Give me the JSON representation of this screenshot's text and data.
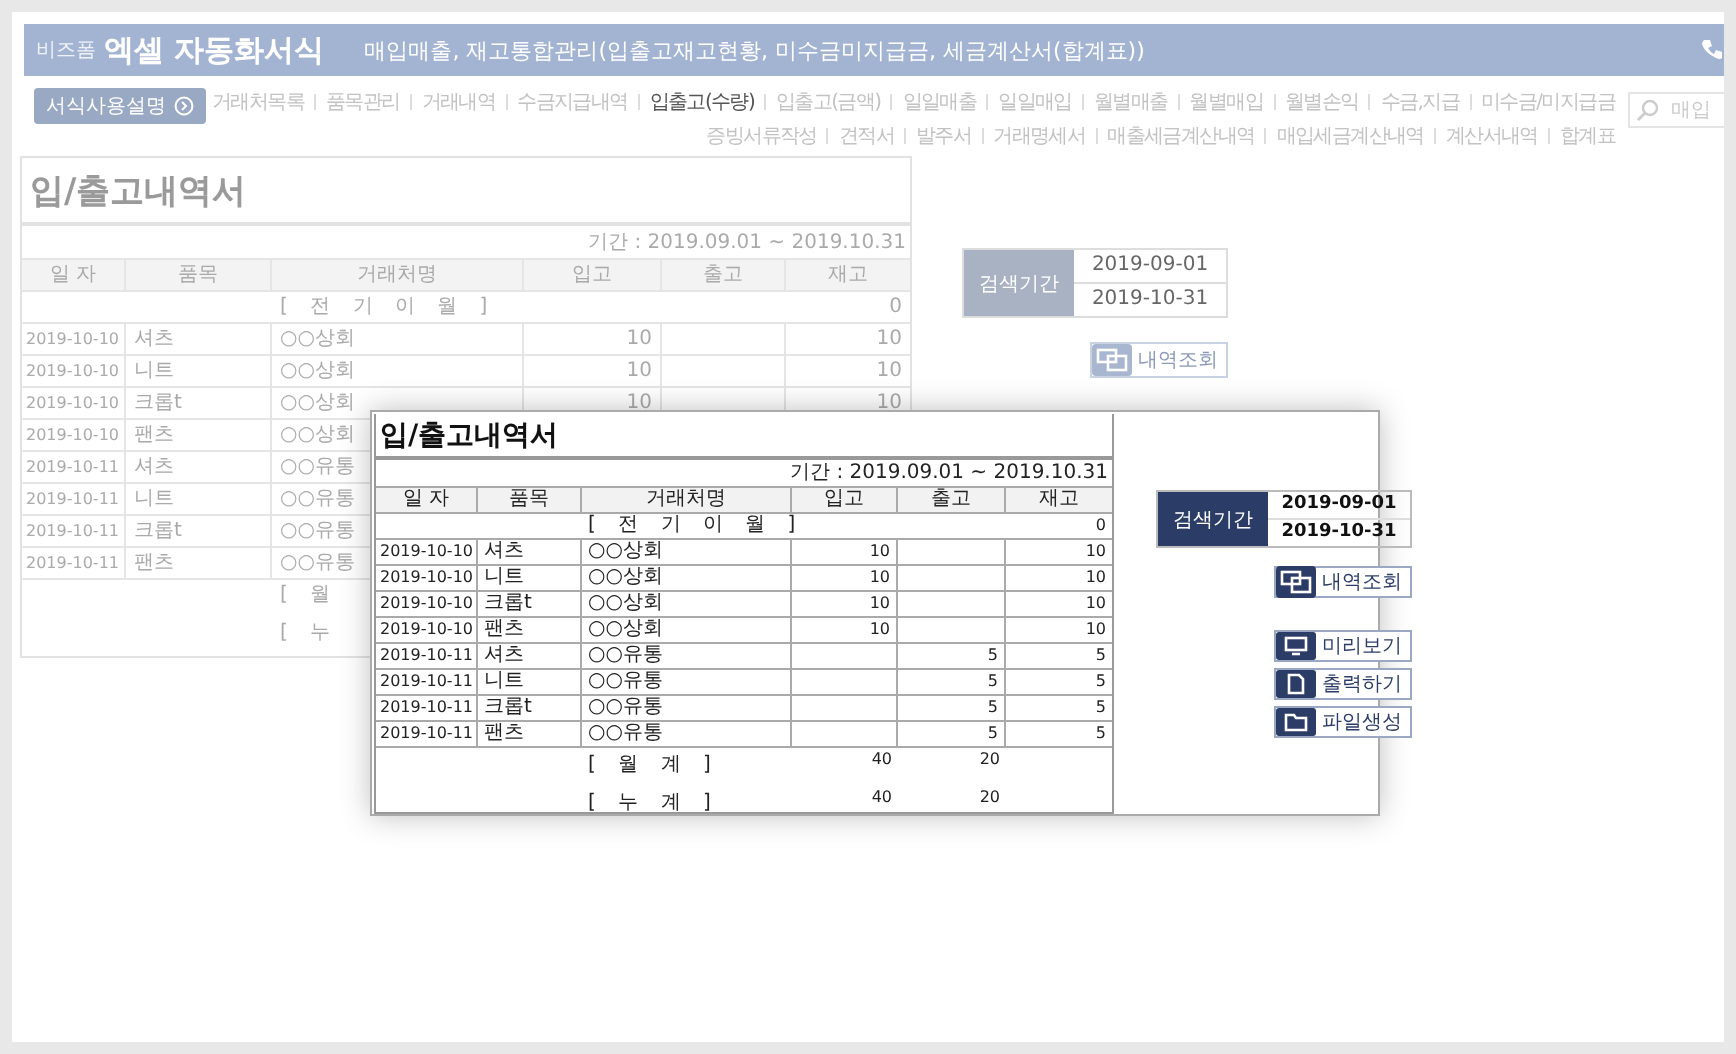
{
  "header": {
    "brand_small": "비즈폼",
    "brand": "엑셀 자동화서식",
    "subtitle": "매입매출, 재고통합관리(입출고재고현황, 미수금미지급금, 세금계산서(합계표))"
  },
  "guide_button": "서식사용설명",
  "nav_primary": [
    {
      "label": "거래처목록",
      "selected": false
    },
    {
      "label": "품목관리",
      "selected": false
    },
    {
      "label": "거래내역",
      "selected": false
    },
    {
      "label": "수금지급내역",
      "selected": false
    },
    {
      "label": "입출고(수량)",
      "selected": true
    },
    {
      "label": "입출고(금액)",
      "selected": false
    },
    {
      "label": "일일매출",
      "selected": false
    },
    {
      "label": "일일매입",
      "selected": false
    },
    {
      "label": "월별매출",
      "selected": false
    },
    {
      "label": "월별매입",
      "selected": false
    },
    {
      "label": "월별손익",
      "selected": false
    },
    {
      "label": "수금,지급",
      "selected": false
    },
    {
      "label": "미수금/미지급금",
      "selected": false
    }
  ],
  "nav_secondary": [
    {
      "label": "증빙서류작성",
      "selected": false
    },
    {
      "label": "견적서",
      "selected": false
    },
    {
      "label": "발주서",
      "selected": false
    },
    {
      "label": "거래명세서",
      "selected": false
    },
    {
      "label": "매출세금계산내역",
      "selected": false
    },
    {
      "label": "매입세금계산내역",
      "selected": false
    },
    {
      "label": "계산서내역",
      "selected": false
    },
    {
      "label": "합계표",
      "selected": false
    }
  ],
  "search": {
    "placeholder": "매입"
  },
  "background_sheet": {
    "title": "입/출고내역서",
    "period": "기간 : 2019.09.01 ~ 2019.10.31",
    "columns": [
      "일 자",
      "품목",
      "거래처명",
      "입고",
      "출고",
      "재고"
    ],
    "carry_row": {
      "label": "[ 전 기 이 월 ]",
      "stock": "0"
    },
    "rows": [
      {
        "date": "2019-10-10",
        "item": "셔츠",
        "partner": "○○상회",
        "in": "10",
        "stock": "10"
      },
      {
        "date": "2019-10-10",
        "item": "니트",
        "partner": "○○상회",
        "in": "10",
        "stock": "10"
      },
      {
        "date": "2019-10-10",
        "item": "크롭t",
        "partner": "○○상회",
        "in": "10",
        "stock": "10"
      },
      {
        "date": "2019-10-10",
        "item": "팬츠",
        "partner": "○○상회"
      },
      {
        "date": "2019-10-11",
        "item": "셔츠",
        "partner": "○○유통"
      },
      {
        "date": "2019-10-11",
        "item": "니트",
        "partner": "○○유통"
      },
      {
        "date": "2019-10-11",
        "item": "크롭t",
        "partner": "○○유통"
      },
      {
        "date": "2019-10-11",
        "item": "팬츠",
        "partner": "○○유통"
      }
    ],
    "totals": [
      {
        "label": "[ 월"
      },
      {
        "label": "[ 누"
      }
    ]
  },
  "background_panel": {
    "label": "검색기간",
    "from": "2019-09-01",
    "to": "2019-10-31",
    "button": "내역조회"
  },
  "popup": {
    "sheet": {
      "title": "입/출고내역서",
      "period": "기간 : 2019.09.01 ~ 2019.10.31",
      "columns": [
        "일 자",
        "품목",
        "거래처명",
        "입고",
        "출고",
        "재고"
      ],
      "carry_row": {
        "label": "[ 전 기 이 월 ]",
        "stock": "0"
      },
      "rows": [
        {
          "date": "2019-10-10",
          "item": "셔츠",
          "partner": "○○상회",
          "in": "10",
          "stock": "10"
        },
        {
          "date": "2019-10-10",
          "item": "니트",
          "partner": "○○상회",
          "in": "10",
          "stock": "10"
        },
        {
          "date": "2019-10-10",
          "item": "크롭t",
          "partner": "○○상회",
          "in": "10",
          "stock": "10"
        },
        {
          "date": "2019-10-10",
          "item": "팬츠",
          "partner": "○○상회",
          "in": "10",
          "stock": "10"
        },
        {
          "date": "2019-10-11",
          "item": "셔츠",
          "partner": "○○유통",
          "out": "5",
          "stock": "5"
        },
        {
          "date": "2019-10-11",
          "item": "니트",
          "partner": "○○유통",
          "out": "5",
          "stock": "5"
        },
        {
          "date": "2019-10-11",
          "item": "크롭t",
          "partner": "○○유통",
          "out": "5",
          "stock": "5"
        },
        {
          "date": "2019-10-11",
          "item": "팬츠",
          "partner": "○○유통",
          "out": "5",
          "stock": "5"
        }
      ],
      "totals": [
        {
          "label": "[ 월 계 ]",
          "in": "40",
          "out": "20"
        },
        {
          "label": "[ 누 계 ]",
          "in": "40",
          "out": "20"
        }
      ]
    },
    "panel": {
      "label": "검색기간",
      "from": "2019-09-01",
      "to": "2019-10-31",
      "button": "내역조회"
    },
    "actions": [
      {
        "label": "미리보기",
        "kind": "preview"
      },
      {
        "label": "출력하기",
        "kind": "print"
      },
      {
        "label": "파일생성",
        "kind": "file"
      }
    ]
  }
}
